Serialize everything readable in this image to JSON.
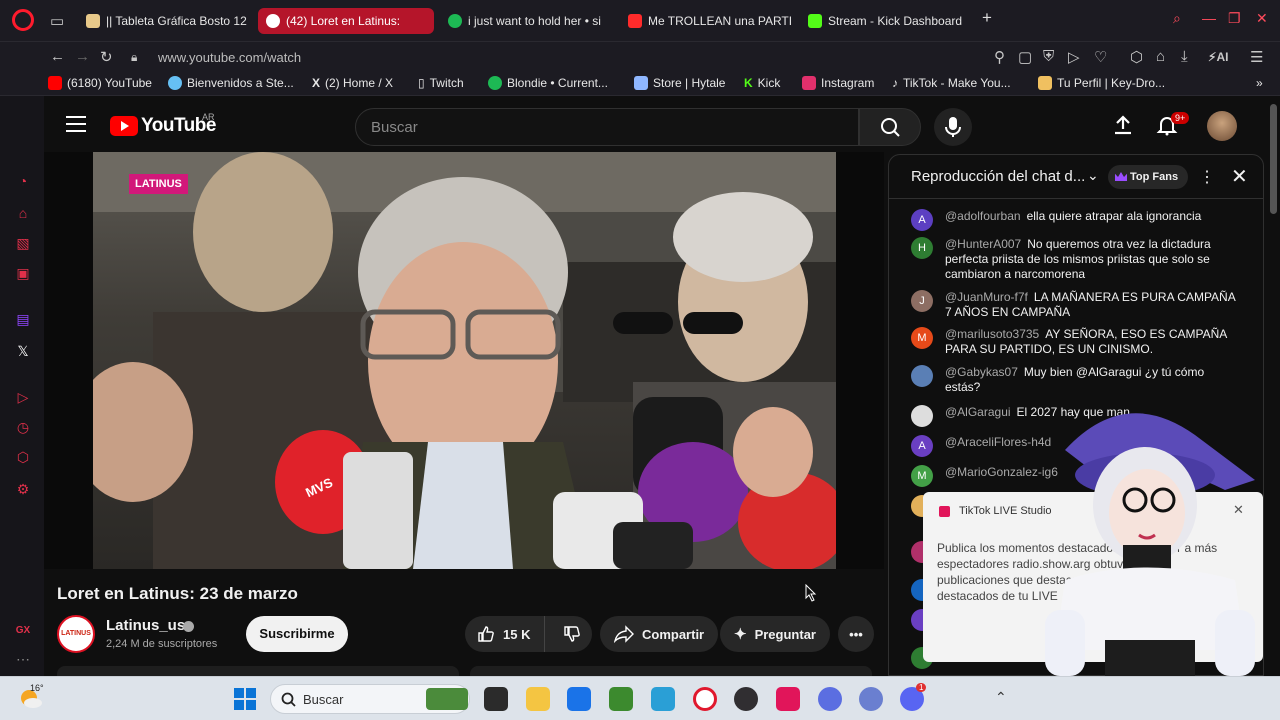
{
  "browser": {
    "tabs": [
      {
        "label": "|| Tableta Gráfica Bosto 12",
        "color": "#e8c98a"
      },
      {
        "label": "(42) Loret en Latinus:",
        "color": "#ff2b2b",
        "active": true
      },
      {
        "label": "i just want to hold her • si",
        "color": "#1db954"
      },
      {
        "label": "Me TROLLEAN una PARTI",
        "color": "#ff2b2b"
      },
      {
        "label": "Stream - Kick Dashboard",
        "color": "#53fc18"
      }
    ],
    "url": "www.youtube.com/watch",
    "ai_label": "AI",
    "bookmarks": [
      {
        "label": "(6180) YouTube",
        "color": "#ff0000"
      },
      {
        "label": "Bienvenidos a Ste...",
        "color": "#66c0f4"
      },
      {
        "label": "(2) Home / X",
        "color": "#ffffff"
      },
      {
        "label": "Twitch",
        "color": "#dddddd"
      },
      {
        "label": "Blondie • Current...",
        "color": "#1db954"
      },
      {
        "label": "Store | Hytale",
        "color": "#8fb7ff"
      },
      {
        "label": "Kick",
        "color": "#53fc18"
      },
      {
        "label": "Instagram",
        "color": "#e1306c"
      },
      {
        "label": "TikTok - Make You...",
        "color": "#ffffff"
      },
      {
        "label": "Tu Perfil | Key-Dro...",
        "color": "#f0c060"
      }
    ]
  },
  "youtube": {
    "logo_text": "YouTube",
    "region": "AR",
    "search_placeholder": "Buscar",
    "notification_count": "9+"
  },
  "video": {
    "overlay_logo": "LATINUS",
    "mic_brand": "MVS",
    "title": "Loret en Latinus: 23 de marzo",
    "channel_name": "Latinus_us",
    "channel_avatar_text": "LATINUS",
    "subscribers": "2,24 M de suscriptores",
    "subscribe_label": "Suscribirme",
    "likes": "15 K",
    "share_label": "Compartir",
    "ask_label": "Preguntar"
  },
  "chat": {
    "title": "Reproducción del chat d...",
    "top_fans_label": "Top Fans",
    "messages": [
      {
        "initial": "A",
        "color": "#5c3fc2",
        "user": "@adolfourban",
        "text": "ella quiere atrapar ala ignorancia"
      },
      {
        "initial": "H",
        "color": "#2e7d32",
        "user": "@HunterA007",
        "text": "No queremos otra vez la dictadura perfecta priista de los mismos priistas que solo se cambiaron a narcomorena"
      },
      {
        "initial": "J",
        "color": "#8d6e63",
        "user": "@JuanMuro-f7f",
        "text": "LA MAÑANERA ES PURA CAMPAÑA 7 AÑOS EN CAMPAÑA"
      },
      {
        "initial": "M",
        "color": "#e64a19",
        "user": "@marilusoto3735",
        "text": "AY SEÑORA, ESO ES CAMPAÑA PARA SU PARTIDO, ES UN CINISMO."
      },
      {
        "initial": "",
        "color": "#5a7fb5",
        "user": "@Gabykas07",
        "text": "Muy bien @AlGaragui ¿y tú cómo estás?"
      },
      {
        "initial": "",
        "color": "#dddddd",
        "user": "@AlGaragui",
        "text": "El 2027 hay que man"
      },
      {
        "initial": "A",
        "color": "#6a3fc2",
        "user": "@AraceliFlores-h4d",
        "text": ""
      },
      {
        "initial": "M",
        "color": "#43a047",
        "user": "@MarioGonzalez-ig6",
        "text": ""
      }
    ]
  },
  "tiktok_popup": {
    "title": "TikTok LIVE Studio",
    "body": "Publica los momentos destacados para atraer a más espectadores radio.show.arg obtuvo de las publicaciones que destacados. Echa un vistazo a los destacados de tu LIVE"
  },
  "taskbar": {
    "temperature": "16°",
    "search_placeholder": "Buscar",
    "discord_badge": "1",
    "apps": [
      {
        "name": "file-explorer",
        "color": "#f4c542"
      },
      {
        "name": "store",
        "color": "#1a73e8"
      },
      {
        "name": "minecraft",
        "color": "#3c8a2e"
      },
      {
        "name": "photos",
        "color": "#2a9fd6"
      },
      {
        "name": "opera",
        "color": "#e0182d"
      },
      {
        "name": "obs",
        "color": "#302e31"
      },
      {
        "name": "tiktok",
        "color": "#e1155a"
      },
      {
        "name": "app-blue-1",
        "color": "#5b6ee1"
      },
      {
        "name": "app-blue-2",
        "color": "#6a7fd0"
      },
      {
        "name": "discord",
        "color": "#5865f2"
      }
    ]
  }
}
